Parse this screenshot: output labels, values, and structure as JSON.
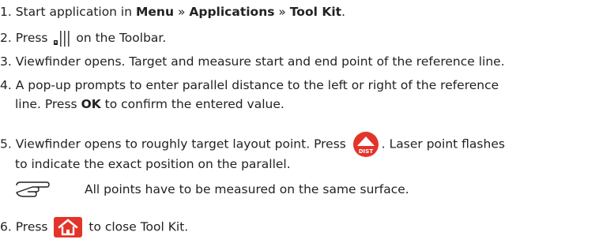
{
  "steps": {
    "s1": {
      "prefix": "1. Start application in ",
      "b1": "Menu",
      "sep1": " » ",
      "b2": "Applications",
      "sep2": " » ",
      "b3": "Tool Kit",
      "end": "."
    },
    "s2": {
      "prefix": "2. Press ",
      "suffix": " on the Toolbar."
    },
    "s3": {
      "text": "3. Viewfinder opens. Target and measure start and end point of the reference line."
    },
    "s4": {
      "line1": "4. A pop-up prompts to enter parallel distance to the left or right of the reference",
      "l2a": "line. Press ",
      "ok": "OK",
      "l2b": " to confirm the entered value."
    },
    "s5": {
      "l1a": "5. Viewfinder opens to roughly target layout point. Press ",
      "l1b": ". Laser point flashes",
      "line2": "to indicate the exact position on the parallel."
    },
    "note": {
      "text": "All points have to be measured on the same surface."
    },
    "s6": {
      "prefix": "6. Press ",
      "suffix": " to close Tool Kit."
    }
  },
  "icons": {
    "toolbar": "parallel-lines-toolbar-icon",
    "dist": "dist-button-icon",
    "dist_label": "DIST",
    "home": "home-button-icon",
    "note": "pointing-hand-icon",
    "accent": "#e3342a"
  }
}
